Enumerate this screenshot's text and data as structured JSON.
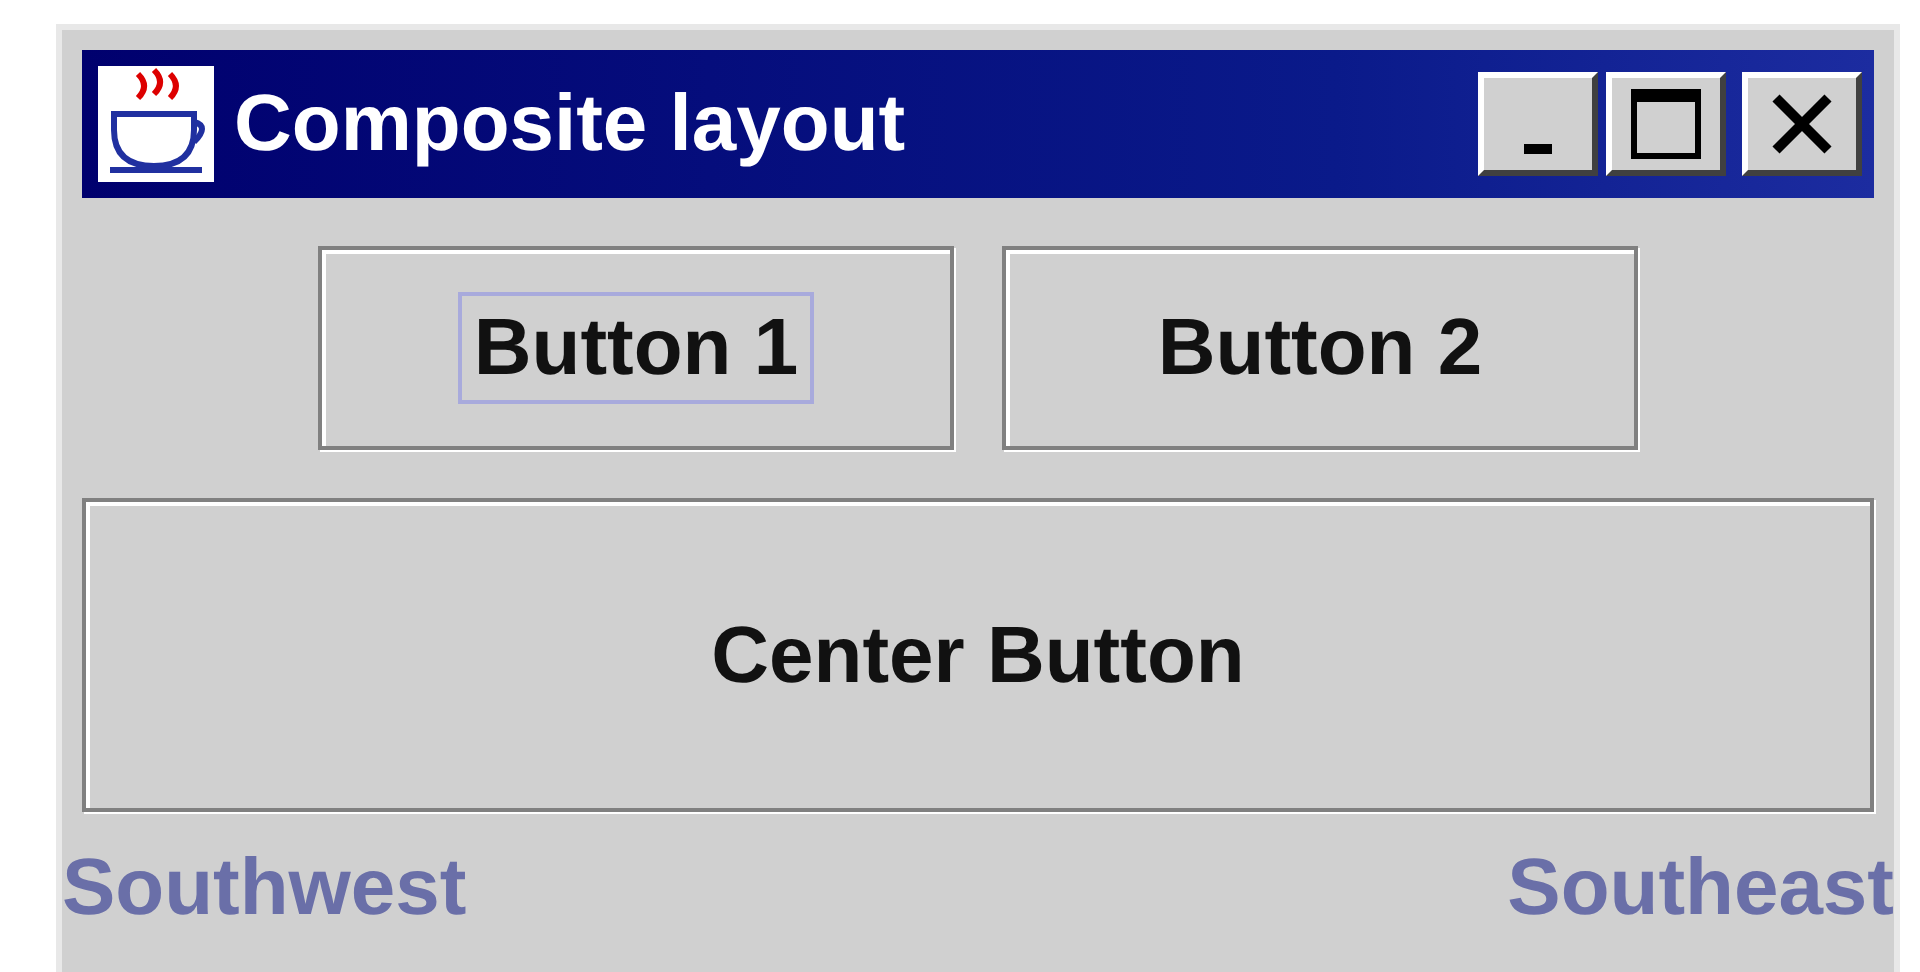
{
  "window": {
    "title": "Composite layout"
  },
  "top_buttons": [
    {
      "label": "Button 1",
      "focused": true
    },
    {
      "label": "Button 2",
      "focused": false
    }
  ],
  "center_button": {
    "label": "Center Button"
  },
  "footer": {
    "left": "Southwest",
    "right": "Southeast"
  }
}
